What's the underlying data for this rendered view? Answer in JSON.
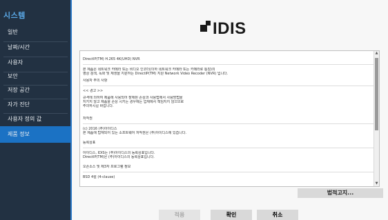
{
  "sidebar": {
    "title": "시스템",
    "items": [
      {
        "label": "일반"
      },
      {
        "label": "날짜/시간"
      },
      {
        "label": "사용자"
      },
      {
        "label": "보안"
      },
      {
        "label": "저장 공간"
      },
      {
        "label": "자가 진단"
      },
      {
        "label": "사용자 정의 값"
      },
      {
        "label": "제품 정보"
      }
    ],
    "active_index": 7
  },
  "logo": {
    "text": "IDIS"
  },
  "license_text": {
    "product": "DirectIP(TM) H.265 4K(UHD) NVR",
    "intro": [
      "본 제품은 네트워크 카메라 또는 비디오 인코더(이하 네트워크 카메라 또는 카메라로 통칭)의",
      "영상 검색, 녹화 및 재생을 지원하는 DirectIP(TM) 지원 Network Video Recoder (NVR) 입니다."
    ],
    "caution_title": "사용자 주의 사항",
    "warning_heading": "<< 경고 >>",
    "warning": [
      "규격에 의하여 제품에 사용되어 장애된 손상과 사용법에서 사용방법을",
      "지키지 않고 제품을 손상 시키는 경우에는 업체에서 책임지지 않으므로",
      "주의하시길 바랍니다."
    ],
    "copyright_title": "저작권",
    "copyright": [
      "(c) 2016 (주)아이디스",
      "본 제품에 탑재되어 있는 소프트웨어 저작권은 (주)아이디스에 있습니다."
    ],
    "trademark_title": "등록상표",
    "trademark": [
      "아이디스, IDIS는 (주)아이디스의 등록상표입니다.",
      "DirectIP(TM)은 (주)아이디스의 등록상표입니다."
    ],
    "opensource_title": "오픈소스 및 제3자 프로그램 정보",
    "opensource_first": "BSD 4절 (4-clause)"
  },
  "legal_button": "법적고지...",
  "buttons": {
    "apply": "적용",
    "ok": "확인",
    "cancel": "취소"
  },
  "colors": {
    "sidebar_bg": "#223142",
    "accent": "#1b72c4",
    "sidebar_title": "#5aa8e6"
  }
}
